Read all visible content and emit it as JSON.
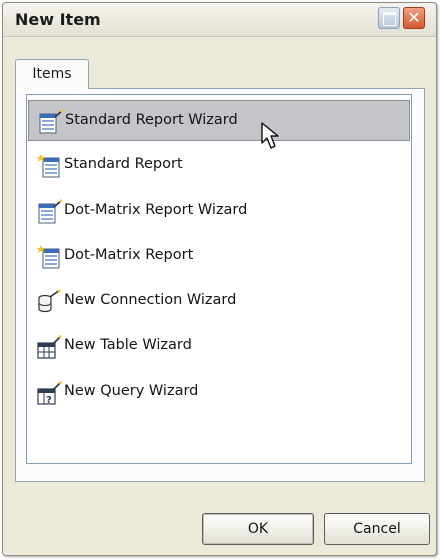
{
  "window": {
    "title": "New Item",
    "close_glyph": "✕"
  },
  "tabs": [
    {
      "label": "Items",
      "selected": true
    }
  ],
  "items": [
    {
      "label": "Standard Report Wizard",
      "icon": "report-wizard-icon",
      "selected": true
    },
    {
      "label": "Standard Report",
      "icon": "report-icon",
      "selected": false
    },
    {
      "label": "Dot-Matrix Report Wizard",
      "icon": "report-wizard-icon",
      "selected": false
    },
    {
      "label": "Dot-Matrix Report",
      "icon": "report-icon",
      "selected": false
    },
    {
      "label": "New Connection Wizard",
      "icon": "connection-wizard-icon",
      "selected": false
    },
    {
      "label": "New Table Wizard",
      "icon": "table-wizard-icon",
      "selected": false
    },
    {
      "label": "New Query Wizard",
      "icon": "query-wizard-icon",
      "selected": false
    }
  ],
  "buttons": {
    "ok": "OK",
    "cancel": "Cancel"
  },
  "colors": {
    "window_bg": "#ece9d8",
    "selection": "#c4c5c9",
    "close_button": "#d4562f"
  }
}
